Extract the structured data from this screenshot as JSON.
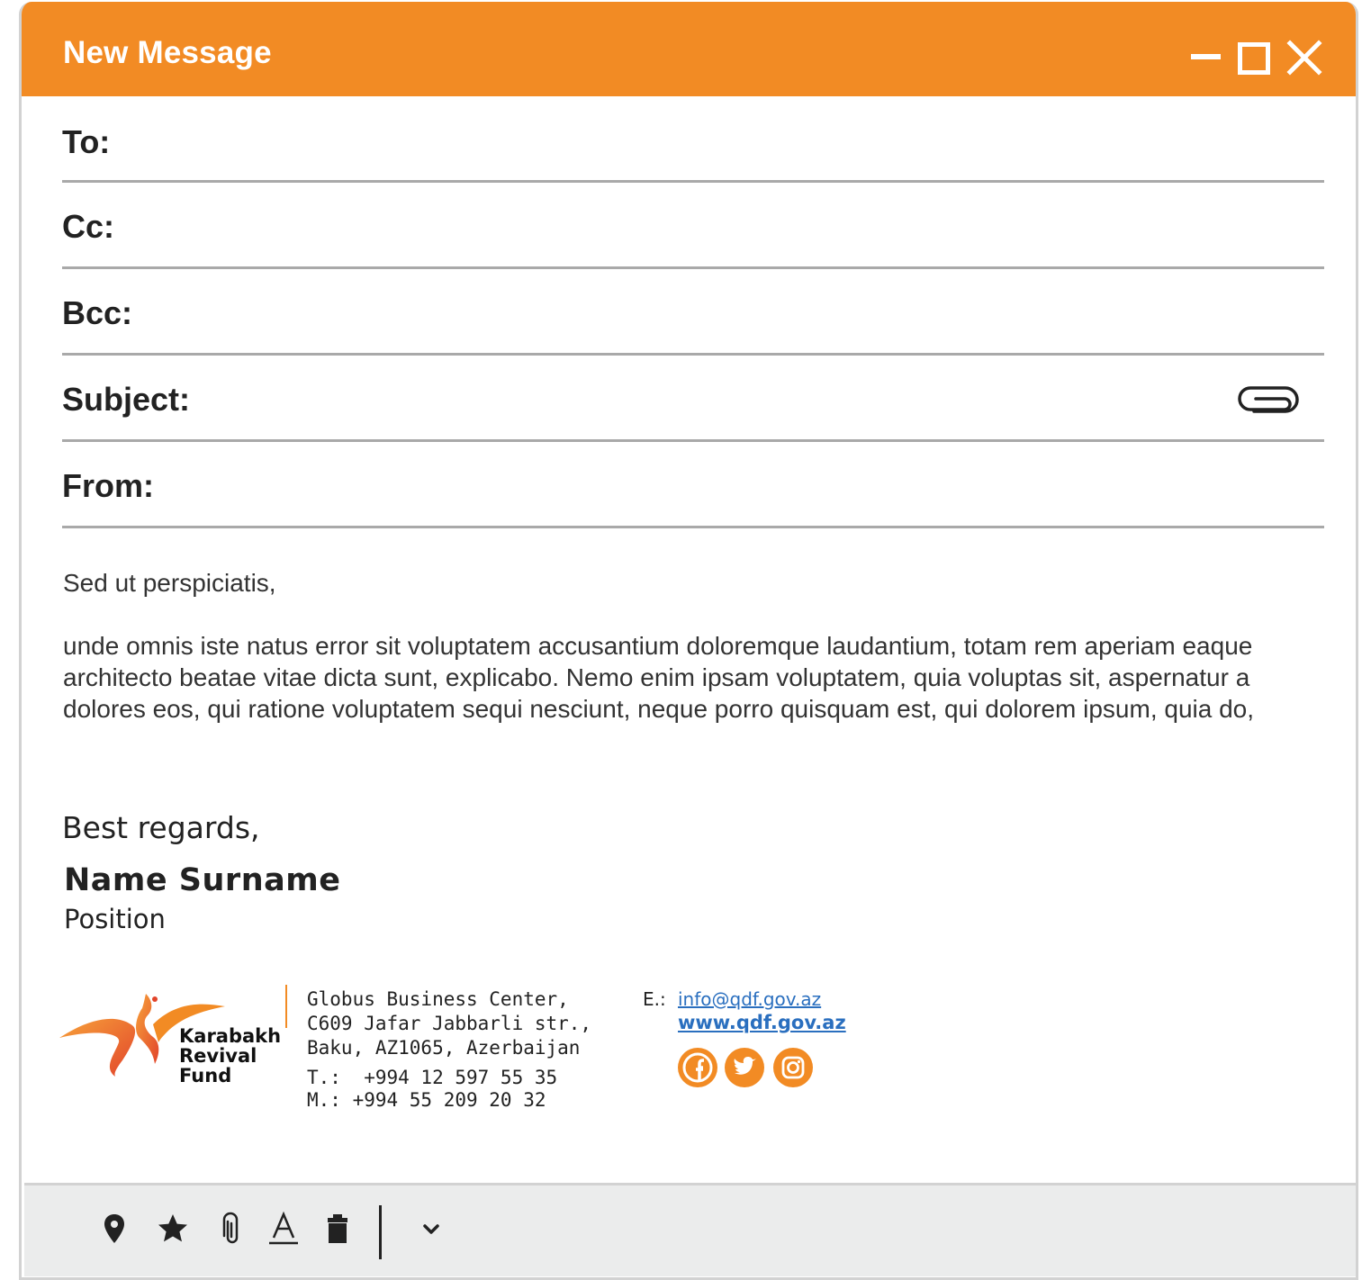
{
  "window": {
    "title": "New Message"
  },
  "fields": {
    "to_label": "To:",
    "cc_label": "Cc:",
    "bcc_label": "Bcc:",
    "subject_label": "Subject:",
    "from_label": "From:"
  },
  "message": {
    "greeting": "Sed ut perspiciatis,",
    "paragraph": "unde omnis iste natus error sit voluptatem accusantium doloremque laudantium, totam rem aperiam eaque architecto beatae vitae dicta sunt, explicabo. Nemo enim ipsam voluptatem, quia voluptas sit, aspernatur a dolores eos, qui ratione voluptatem sequi nesciunt, neque porro quisquam est, qui dolorem ipsum, quia do,"
  },
  "signature": {
    "regards": "Best regards,",
    "name": "Name Surname",
    "position": "Position",
    "logo_lines": [
      "Karabakh",
      "Revival",
      "Fund"
    ],
    "address_lines": [
      "Globus Business Center,",
      "C609 Jafar Jabbarli str.,",
      "Baku, AZ1065, Azerbaijan"
    ],
    "phone_lines": [
      "T.:  +994 12 597 55 35",
      "M.: +994 55 209 20 32"
    ],
    "email_label": "E.:",
    "email": "info@qdf.gov.az",
    "website": "www.qdf.gov.az",
    "social_icons": [
      "facebook-icon",
      "twitter-icon",
      "instagram-icon"
    ]
  },
  "toolbar": {
    "icons": [
      "location-pin-icon",
      "star-icon",
      "paperclip-icon",
      "text-format-icon",
      "trash-icon",
      "chevron-down-icon"
    ]
  },
  "colors": {
    "accent": "#f28b24",
    "link": "#2a6fbf",
    "toolbar_bg": "#ebecec"
  }
}
